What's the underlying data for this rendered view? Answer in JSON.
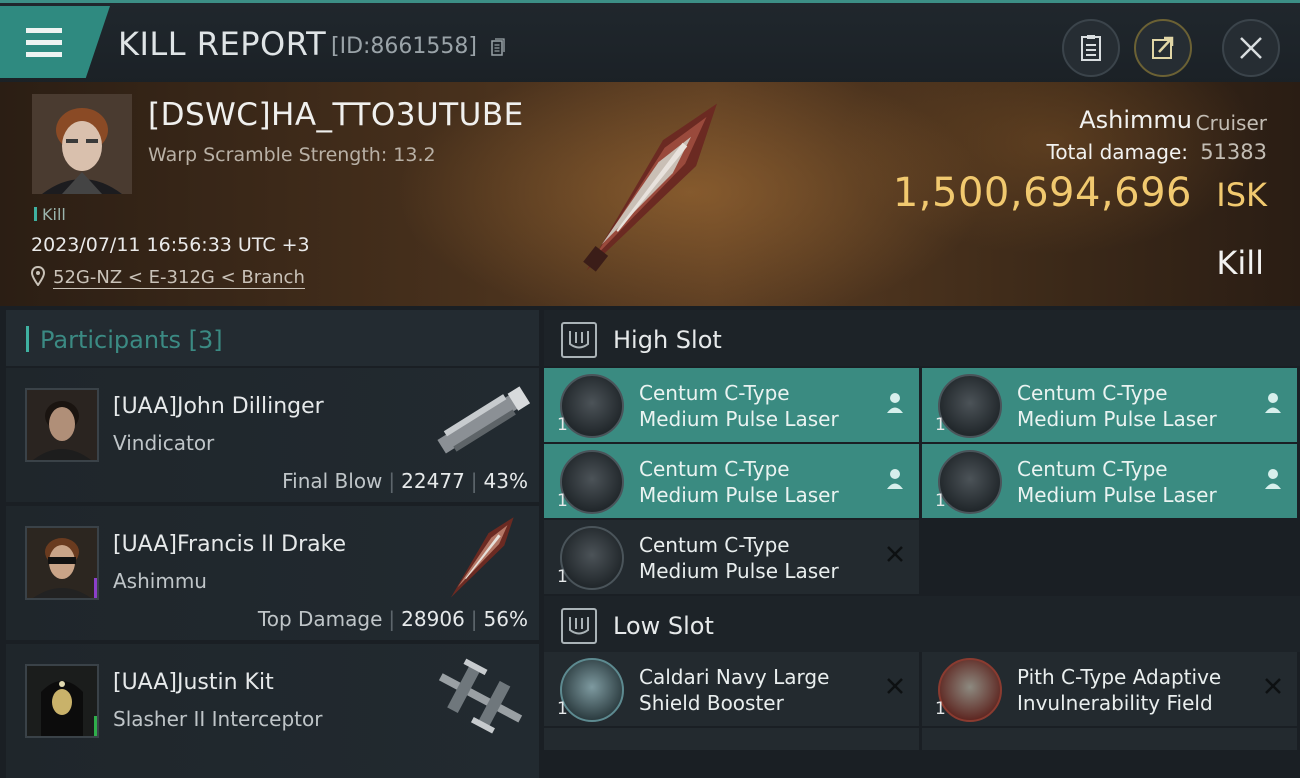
{
  "header": {
    "title": "KILL REPORT",
    "report_id": "[ID:8661558]"
  },
  "victim": {
    "pilot_name": "[DSWC]HA_TTO3UTUBE",
    "warp_scramble": "Warp Scramble Strength: 13.2",
    "tag": "Kill",
    "datetime": "2023/07/11 16:56:33 UTC +3",
    "location": "52G-NZ < E-312G < Branch",
    "ship_name": "Ashimmu",
    "ship_class": "Cruiser",
    "total_damage_label": "Total damage:",
    "total_damage_value": "51383",
    "isk_value": "1,500,694,696",
    "isk_unit": "ISK",
    "result": "Kill"
  },
  "participants": {
    "title": "Participants",
    "count": "[3]",
    "items": [
      {
        "name": "[UAA]John Dillinger",
        "ship": "Vindicator",
        "label": "Final Blow",
        "damage": "22477",
        "percent": "43%"
      },
      {
        "name": "[UAA]Francis II Drake",
        "ship": "Ashimmu",
        "label": "Top Damage",
        "damage": "28906",
        "percent": "56%",
        "badge": "i"
      },
      {
        "name": "[UAA]Justin Kit",
        "ship": "Slasher II Interceptor",
        "badge": "★"
      }
    ]
  },
  "fitting": {
    "high_slot_title": "High Slot",
    "low_slot_title": "Low Slot",
    "high_slot": [
      {
        "line1": "Centum C-Type",
        "line2": "Medium Pulse Laser",
        "qty": "1",
        "status": "dropped"
      },
      {
        "line1": "Centum C-Type",
        "line2": "Medium Pulse Laser",
        "qty": "1",
        "status": "dropped"
      },
      {
        "line1": "Centum C-Type",
        "line2": "Medium Pulse Laser",
        "qty": "1",
        "status": "dropped"
      },
      {
        "line1": "Centum C-Type",
        "line2": "Medium Pulse Laser",
        "qty": "1",
        "status": "dropped"
      },
      {
        "line1": "Centum C-Type",
        "line2": "Medium Pulse Laser",
        "qty": "1",
        "status": "destroyed"
      }
    ],
    "low_slot": [
      {
        "line1": "Caldari Navy Large",
        "line2": "Shield Booster",
        "qty": "1",
        "status": "destroyed"
      },
      {
        "line1": "Pith C-Type Adaptive",
        "line2": "Invulnerability Field",
        "qty": "1",
        "status": "destroyed"
      }
    ]
  },
  "colors": {
    "accent": "#3a8b81",
    "isk": "#f1c96f"
  }
}
